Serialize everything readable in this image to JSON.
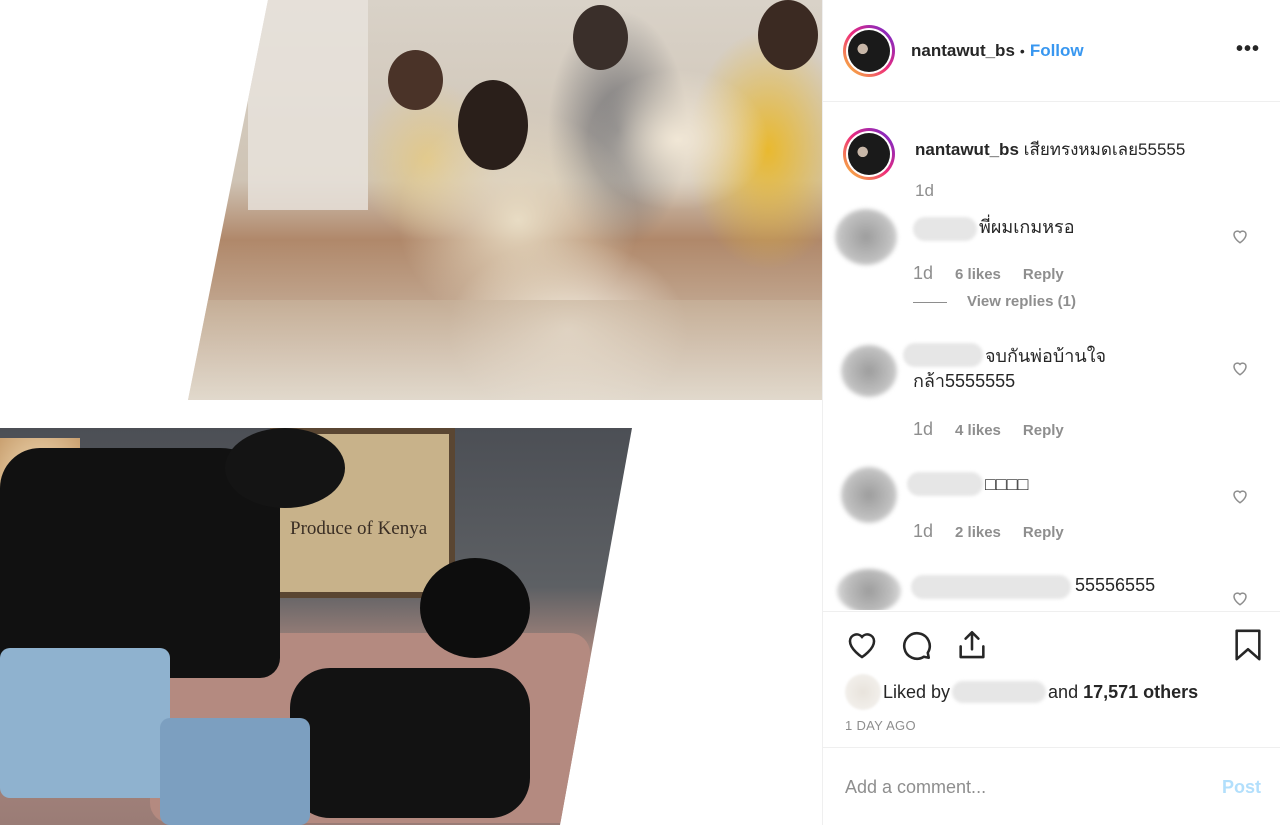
{
  "post": {
    "username": "nantawut_bs",
    "separator": "•",
    "follow_label": "Follow",
    "more_label": "•••"
  },
  "caption": {
    "username": "nantawut_bs",
    "text": " เสียทรงหมดเลย55555",
    "time": "1d"
  },
  "comments": [
    {
      "text": "พี่ผมเกมหรอ",
      "time": "1d",
      "likes": "6 likes",
      "reply": "Reply",
      "view_replies": "View replies (1)"
    },
    {
      "text_line1": "จบกันพ่อบ้านใจ",
      "text_line2": "กล้า5555555",
      "time": "1d",
      "likes": "4 likes",
      "reply": "Reply"
    },
    {
      "text": "□□□□",
      "time": "1d",
      "likes": "2 likes",
      "reply": "Reply"
    },
    {
      "text": "55556555"
    }
  ],
  "likes": {
    "prefix": "Liked by",
    "middle": "and",
    "count": "17,571 others"
  },
  "date": "1 DAY AGO",
  "add_comment": {
    "placeholder": "Add a comment...",
    "post_label": "Post"
  },
  "photo": {
    "sign_text": "Produce of Kenya"
  },
  "colors": {
    "link": "#3897f0",
    "muted": "#8e8e8e",
    "post_disabled": "#b2dffc"
  }
}
